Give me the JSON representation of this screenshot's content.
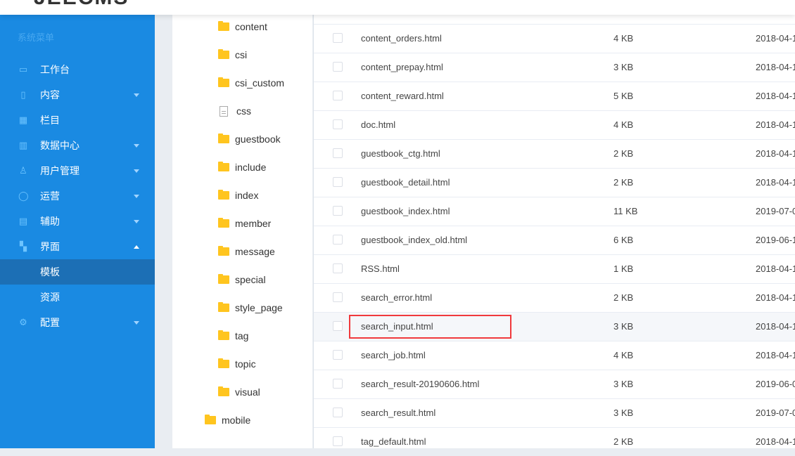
{
  "header": {
    "logo": "JEECMS"
  },
  "sidebar": {
    "title": "系统菜单",
    "items": [
      {
        "label": "工作台",
        "icon": "monitor-icon",
        "arrow": "none"
      },
      {
        "label": "内容",
        "icon": "document-icon",
        "arrow": "down"
      },
      {
        "label": "栏目",
        "icon": "grid-icon",
        "arrow": "none"
      },
      {
        "label": "数据中心",
        "icon": "bar-chart-icon",
        "arrow": "down"
      },
      {
        "label": "用户管理",
        "icon": "user-icon",
        "arrow": "down"
      },
      {
        "label": "运营",
        "icon": "shield-icon",
        "arrow": "down"
      },
      {
        "label": "辅助",
        "icon": "toolbox-icon",
        "arrow": "down"
      },
      {
        "label": "界面",
        "icon": "layout-icon",
        "arrow": "up"
      },
      {
        "label": "模板",
        "icon": "",
        "arrow": "none",
        "sub": true,
        "active": true
      },
      {
        "label": "资源",
        "icon": "",
        "arrow": "none",
        "sub": true
      },
      {
        "label": "配置",
        "icon": "gear-icon",
        "arrow": "down"
      }
    ]
  },
  "tree": {
    "items": [
      {
        "label": "content",
        "type": "folder"
      },
      {
        "label": "csi",
        "type": "folder"
      },
      {
        "label": "csi_custom",
        "type": "folder"
      },
      {
        "label": "css",
        "type": "file"
      },
      {
        "label": "guestbook",
        "type": "folder"
      },
      {
        "label": "include",
        "type": "folder"
      },
      {
        "label": "index",
        "type": "folder"
      },
      {
        "label": "member",
        "type": "folder"
      },
      {
        "label": "message",
        "type": "folder"
      },
      {
        "label": "special",
        "type": "folder"
      },
      {
        "label": "style_page",
        "type": "folder"
      },
      {
        "label": "tag",
        "type": "folder"
      },
      {
        "label": "topic",
        "type": "folder"
      },
      {
        "label": "visual",
        "type": "folder"
      },
      {
        "label": "mobile",
        "type": "folder",
        "level": 0
      }
    ]
  },
  "files": [
    {
      "name": "content_orders.html",
      "size": "4 KB",
      "date": "2018-04-1"
    },
    {
      "name": "content_prepay.html",
      "size": "3 KB",
      "date": "2018-04-1"
    },
    {
      "name": "content_reward.html",
      "size": "5 KB",
      "date": "2018-04-1"
    },
    {
      "name": "doc.html",
      "size": "4 KB",
      "date": "2018-04-1"
    },
    {
      "name": "guestbook_ctg.html",
      "size": "2 KB",
      "date": "2018-04-1"
    },
    {
      "name": "guestbook_detail.html",
      "size": "2 KB",
      "date": "2018-04-1"
    },
    {
      "name": "guestbook_index.html",
      "size": "11 KB",
      "date": "2019-07-0"
    },
    {
      "name": "guestbook_index_old.html",
      "size": "6 KB",
      "date": "2019-06-1"
    },
    {
      "name": "RSS.html",
      "size": "1 KB",
      "date": "2018-04-1"
    },
    {
      "name": "search_error.html",
      "size": "2 KB",
      "date": "2018-04-1"
    },
    {
      "name": "search_input.html",
      "size": "3 KB",
      "date": "2018-04-1",
      "highlighted": true
    },
    {
      "name": "search_job.html",
      "size": "4 KB",
      "date": "2018-04-1"
    },
    {
      "name": "search_result-20190606.html",
      "size": "3 KB",
      "date": "2019-06-0"
    },
    {
      "name": "search_result.html",
      "size": "3 KB",
      "date": "2019-07-0"
    },
    {
      "name": "tag_default.html",
      "size": "2 KB",
      "date": "2018-04-1"
    }
  ]
}
